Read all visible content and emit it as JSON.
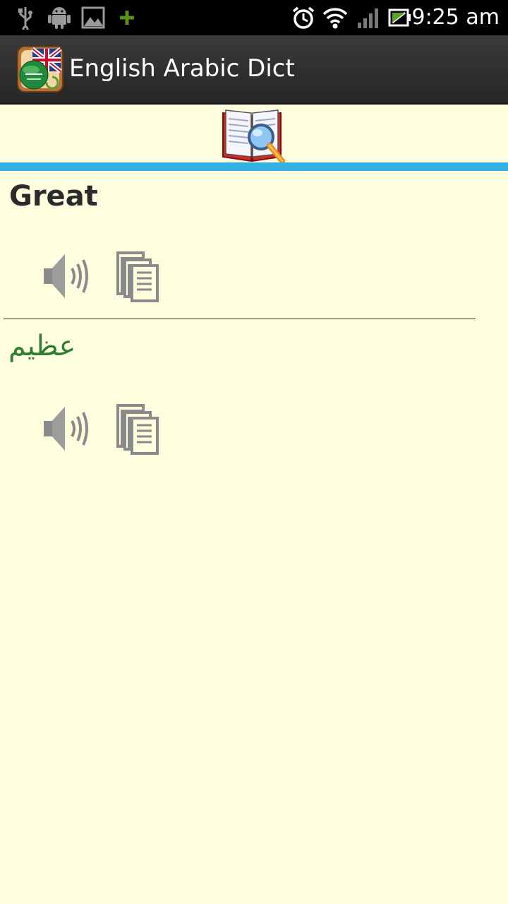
{
  "status_bar": {
    "time": "9:25 am",
    "icons": [
      "usb-icon",
      "android-icon",
      "image-icon",
      "plus-icon",
      "alarm-icon",
      "wifi-icon",
      "signal-icon",
      "battery-icon"
    ]
  },
  "app_bar": {
    "title": "English Arabic Dict",
    "icon": "english-arabic-flag-icon"
  },
  "search": {
    "icon": "book-magnifier-icon"
  },
  "entry": {
    "word": "Great",
    "translation": "عظيم"
  },
  "colors": {
    "background": "#ffffdf",
    "accent_rule": "#33b0e2",
    "translation_text": "#2e7d32",
    "action_bar": "#2e2e2e"
  }
}
